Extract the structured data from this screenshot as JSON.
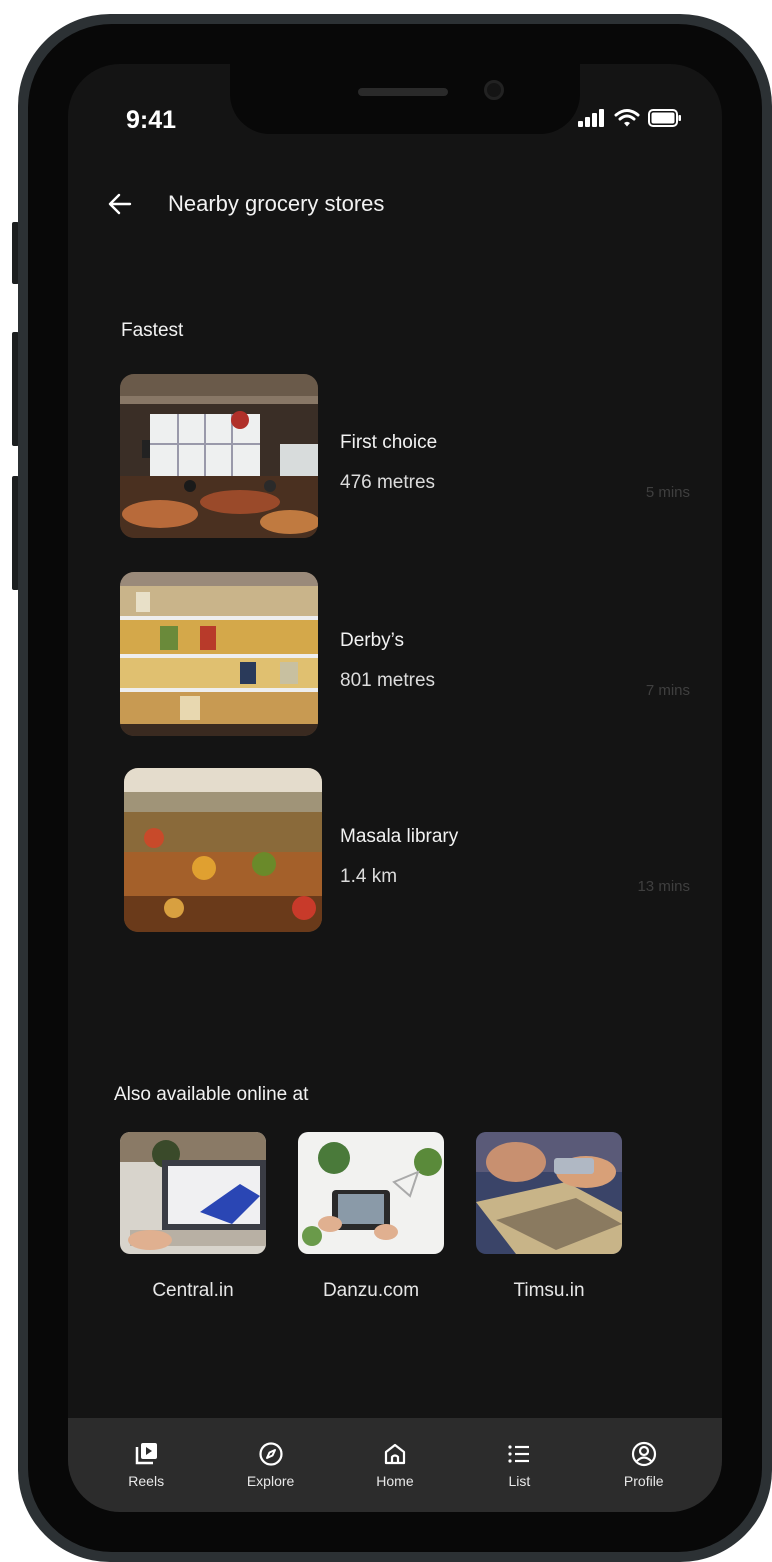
{
  "status_bar": {
    "time": "9:41"
  },
  "header": {
    "title": "Nearby grocery stores"
  },
  "fastest": {
    "heading": "Fastest",
    "stores": [
      {
        "name": "First choice",
        "distance": "476 metres",
        "eta": "5 mins"
      },
      {
        "name": "Derby’s",
        "distance": "801 metres",
        "eta": "7 mins"
      },
      {
        "name": "Masala library",
        "distance": "1.4 km",
        "eta": "13 mins"
      }
    ]
  },
  "online": {
    "heading": "Also available online at",
    "shops": [
      {
        "name": "Central.in"
      },
      {
        "name": "Danzu.com"
      },
      {
        "name": "Timsu.in"
      }
    ]
  },
  "nav": {
    "items": [
      {
        "label": "Reels",
        "icon": "reels-icon"
      },
      {
        "label": "Explore",
        "icon": "compass-icon"
      },
      {
        "label": "Home",
        "icon": "home-icon"
      },
      {
        "label": "List",
        "icon": "list-icon"
      },
      {
        "label": "Profile",
        "icon": "profile-icon"
      }
    ]
  },
  "colors": {
    "background": "#141414",
    "nav_bar": "#2c2c2c",
    "text": "#f2f2f2",
    "muted": "#3f3f3f",
    "frame": "#2c3134"
  }
}
